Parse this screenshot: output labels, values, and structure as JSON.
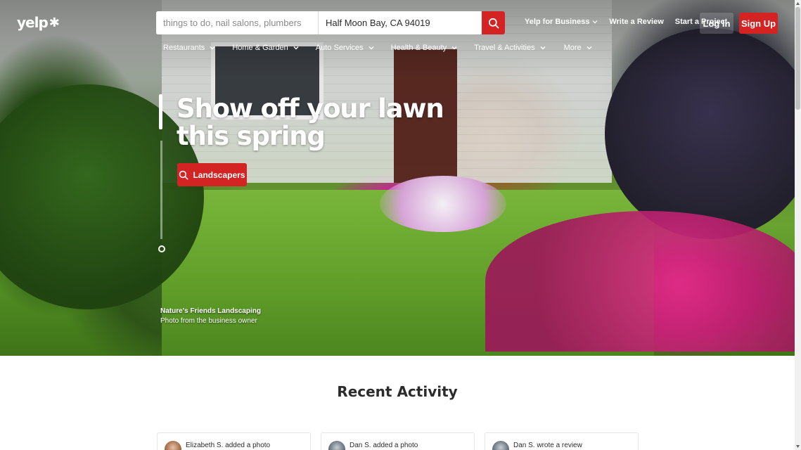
{
  "header": {
    "logo_text": "yelp",
    "search": {
      "find_placeholder": "things to do, nail salons, plumbers",
      "near_value": "Half Moon Bay, CA 94019"
    },
    "top_links": {
      "business": "Yelp for Business",
      "write_review": "Write a Review",
      "start_project": "Start a Project"
    },
    "login_label": "Log In",
    "signup_label": "Sign Up"
  },
  "categories": [
    {
      "label": "Restaurants"
    },
    {
      "label": "Home & Garden"
    },
    {
      "label": "Auto Services"
    },
    {
      "label": "Health & Beauty"
    },
    {
      "label": "Travel & Activities"
    },
    {
      "label": "More"
    }
  ],
  "hero": {
    "headline": "Show off your lawn this spring",
    "cta_label": "Landscapers",
    "credit_business": "Nature's Friends Landscaping",
    "credit_note": "Photo from the business owner"
  },
  "recent_activity": {
    "title": "Recent Activity",
    "cards": [
      {
        "text": "Elizabeth S. added a photo"
      },
      {
        "text": "Dan S. added a photo"
      },
      {
        "text": "Dan S. wrote a review"
      }
    ]
  },
  "colors": {
    "brand_red": "#d32323",
    "text_dark": "#2b2b2b"
  }
}
